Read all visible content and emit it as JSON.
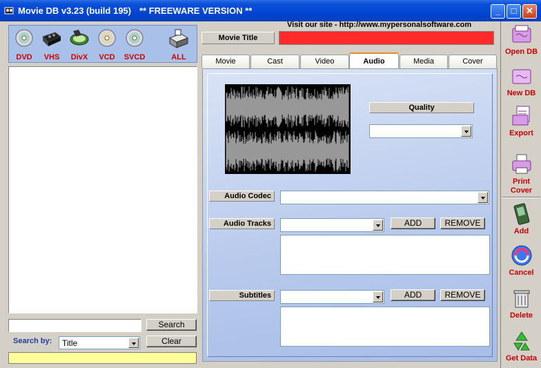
{
  "window": {
    "title": "Movie DB v3.23 (build 195)",
    "title_extra": "** FREEWARE VERSION **",
    "min": "_",
    "max": "□",
    "close": "✕"
  },
  "media_types": [
    {
      "label": "DVD",
      "icon": "disc-icon"
    },
    {
      "label": "VHS",
      "icon": "vhs-tape-icon"
    },
    {
      "label": "DivX",
      "icon": "divx-disc-icon"
    },
    {
      "label": "VCD",
      "icon": "disc-icon"
    },
    {
      "label": "SVCD",
      "icon": "disc-icon"
    },
    {
      "label": "ALL",
      "icon": "drive-icon"
    }
  ],
  "search": {
    "input_value": "",
    "button": "Search",
    "search_by_label": "Search by:",
    "search_by_value": "Title",
    "clear_button": "Clear"
  },
  "header": {
    "site_link": "Visit our site - http://www.mypersonalsoftware.com",
    "movie_title_label": "Movie Title",
    "movie_title_value": ""
  },
  "tabs": [
    {
      "label": "Movie",
      "active": false
    },
    {
      "label": "Cast",
      "active": false
    },
    {
      "label": "Video",
      "active": false
    },
    {
      "label": "Audio",
      "active": true
    },
    {
      "label": "Media",
      "active": false
    },
    {
      "label": "Cover",
      "active": false
    }
  ],
  "audio": {
    "quality_label": "Quality",
    "quality_value": "",
    "codec_label": "Audio Codec",
    "codec_value": "",
    "tracks_label": "Audio Tracks",
    "tracks_value": "",
    "subtitles_label": "Subtitles",
    "subtitles_value": "",
    "add_button": "ADD",
    "remove_button": "REMOVE"
  },
  "sidebar": {
    "open_db": "Open DB",
    "new_db": "New DB",
    "export": "Export",
    "print_cover_1": "Print",
    "print_cover_2": "Cover",
    "add": "Add",
    "cancel": "Cancel",
    "delete": "Delete",
    "get_data": "Get Data"
  },
  "colors": {
    "accent_red": "#cc0000",
    "title_field": "#ff2a2a",
    "status_yellow": "#ffff99",
    "titlebar_blue": "#0043cf"
  }
}
